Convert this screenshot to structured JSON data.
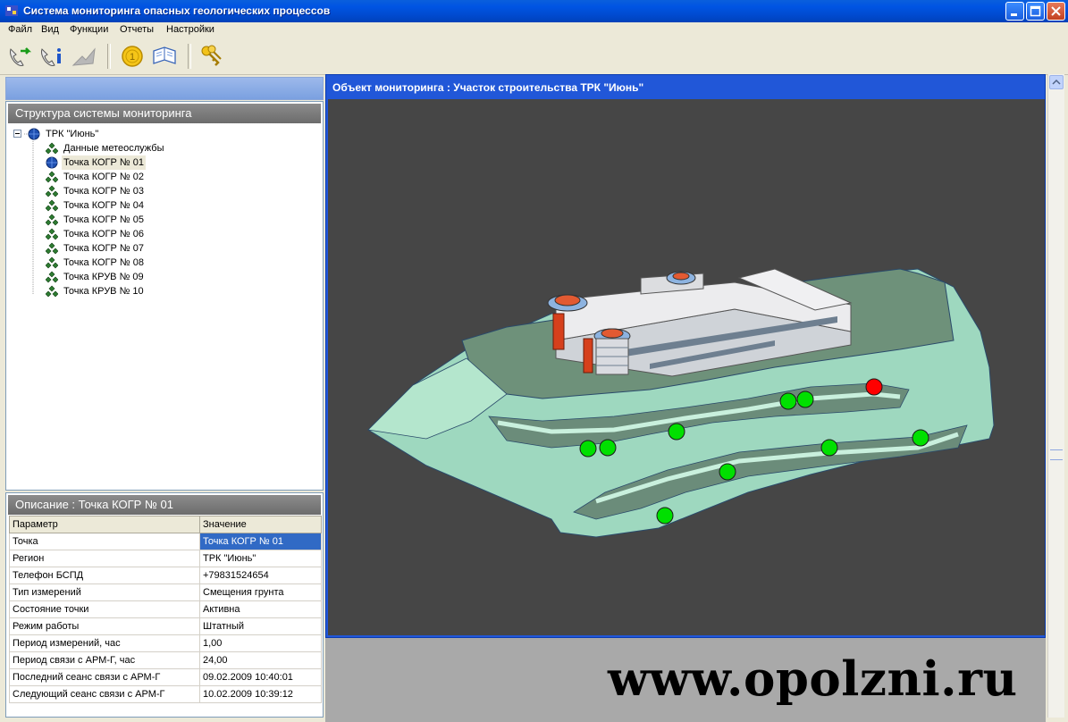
{
  "window": {
    "title": "Система мониторинга опасных геологических процессов",
    "accent": "#0054e3"
  },
  "menu": [
    {
      "label": "Файл"
    },
    {
      "label": "Вид"
    },
    {
      "label": "Функции"
    },
    {
      "label": "Отчеты"
    },
    {
      "label": "Настройки"
    }
  ],
  "toolbar": {
    "buttons": [
      {
        "icon": "connect-phone-icon"
      },
      {
        "icon": "phone-info-icon"
      },
      {
        "icon": "disconnect-icon",
        "disabled": true
      },
      {
        "icon": "coin-icon"
      },
      {
        "icon": "report-book-icon"
      },
      {
        "icon": "keys-icon"
      }
    ]
  },
  "tree_panel": {
    "title": "Структура системы мониторинга",
    "root": "ТРК \"Июнь\"",
    "items": [
      {
        "label": "Данные метеослужбы",
        "icon": "sensor-cluster-icon"
      },
      {
        "label": "Точка КОГР № 01",
        "icon": "globe-icon",
        "selected": true
      },
      {
        "label": "Точка КОГР № 02",
        "icon": "sensor-cluster-icon"
      },
      {
        "label": "Точка КОГР № 03",
        "icon": "sensor-cluster-icon"
      },
      {
        "label": "Точка КОГР № 04",
        "icon": "sensor-cluster-icon"
      },
      {
        "label": "Точка КОГР № 05",
        "icon": "sensor-cluster-icon"
      },
      {
        "label": "Точка КОГР № 06",
        "icon": "sensor-cluster-icon"
      },
      {
        "label": "Точка КОГР № 07",
        "icon": "sensor-cluster-icon"
      },
      {
        "label": "Точка КОГР № 08",
        "icon": "sensor-cluster-icon"
      },
      {
        "label": "Точка КРУВ № 09",
        "icon": "sensor-cluster-icon"
      },
      {
        "label": "Точка КРУВ № 10",
        "icon": "sensor-cluster-icon"
      }
    ]
  },
  "description": {
    "title": "Описание : Точка КОГР № 01",
    "columns": [
      "Параметр",
      "Значение"
    ],
    "rows": [
      [
        "Точка",
        "Точка КОГР № 01"
      ],
      [
        "Регион",
        "ТРК \"Июнь\""
      ],
      [
        "Телефон БСПД",
        "+79831524654"
      ],
      [
        "Тип измерений",
        "Смещения грунта"
      ],
      [
        "Состояние точки",
        "Активна"
      ],
      [
        "Режим работы",
        "Штатный"
      ],
      [
        "Период измерений, час",
        "1,00"
      ],
      [
        "Период связи с АРМ-Г, час",
        "24,00"
      ],
      [
        "Последний сеанс связи с АРМ-Г",
        "09.02.2009 10:40:01"
      ],
      [
        "Следующий сеанс связи с АРМ-Г",
        "10.02.2009 10:39:12"
      ]
    ]
  },
  "viewer": {
    "title": "Объект мониторинга : Участок строительства ТРК \"Июнь\"",
    "status_colors": {
      "ok": "#00e000",
      "alarm": "#ff0000"
    },
    "markers": [
      {
        "status": "alarm"
      },
      {
        "status": "ok"
      },
      {
        "status": "ok"
      },
      {
        "status": "ok"
      },
      {
        "status": "ok"
      },
      {
        "status": "ok"
      },
      {
        "status": "ok"
      },
      {
        "status": "ok"
      },
      {
        "status": "ok"
      },
      {
        "status": "ok"
      },
      {
        "status": "ok"
      }
    ]
  },
  "watermark": "www.opolzni.ru"
}
